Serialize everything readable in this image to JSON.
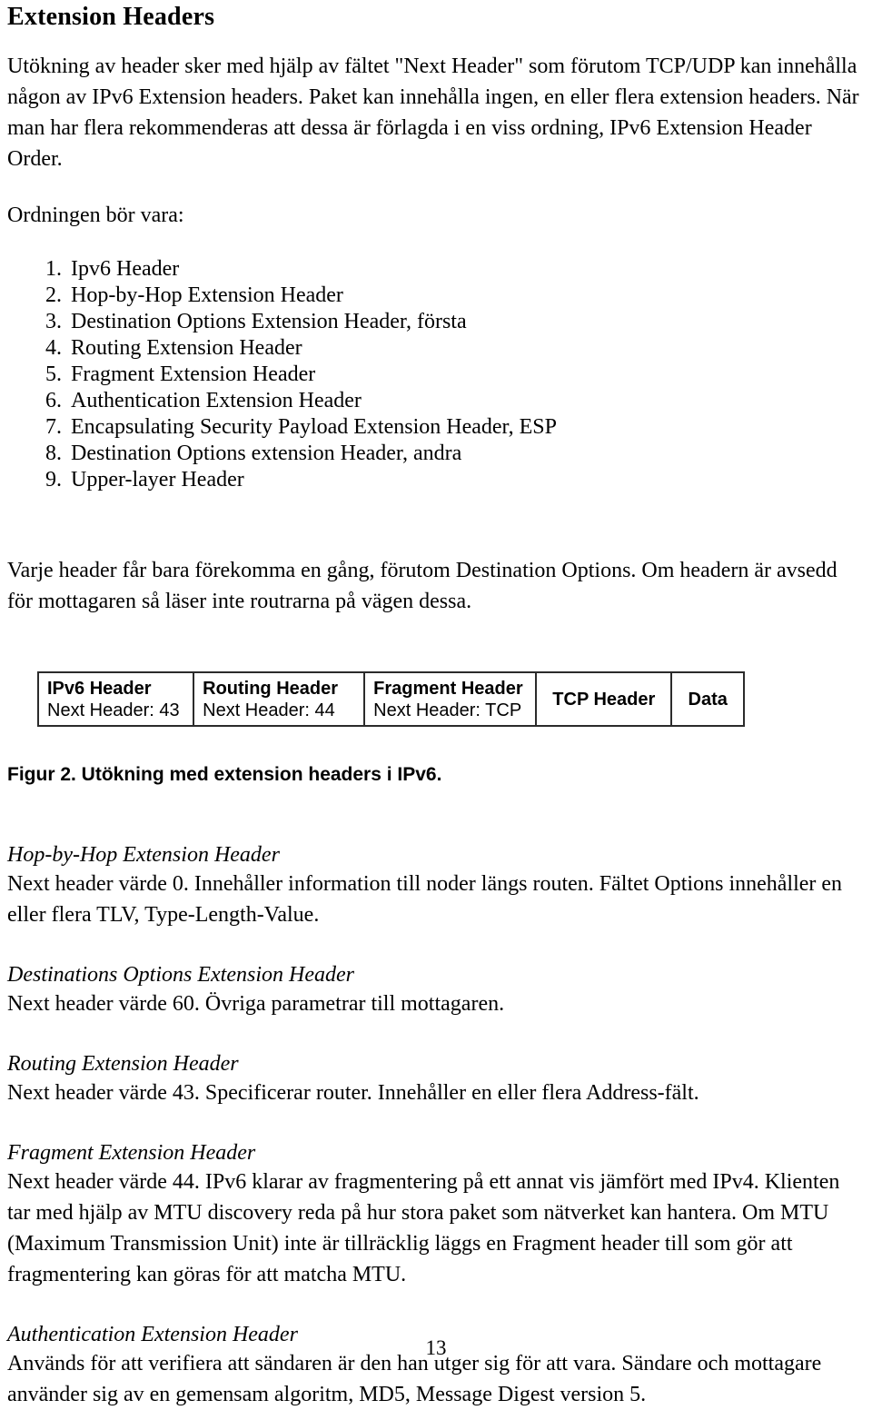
{
  "document": {
    "title": "Extension Headers",
    "page_number": "13"
  },
  "intro": {
    "paragraph": "Utökning av header sker med hjälp av fältet \"Next Header\" som förutom TCP/UDP kan innehålla någon av IPv6 Extension headers. Paket kan innehålla ingen, en eller flera extension headers. När man har flera rekommenderas att dessa är förlagda i en viss ordning, IPv6 Extension Header Order.",
    "order_intro": "Ordningen bör vara:"
  },
  "order_list": [
    {
      "num": "1.",
      "label": "Ipv6 Header"
    },
    {
      "num": "2.",
      "label": "Hop-by-Hop Extension Header"
    },
    {
      "num": "3.",
      "label": "Destination Options Extension Header, första"
    },
    {
      "num": "4.",
      "label": "Routing Extension Header"
    },
    {
      "num": "5.",
      "label": "Fragment Extension Header"
    },
    {
      "num": "6.",
      "label": "Authentication Extension Header"
    },
    {
      "num": "7.",
      "label": "Encapsulating Security Payload Extension Header, ESP"
    },
    {
      "num": "8.",
      "label": "Destination Options extension Header, andra"
    },
    {
      "num": "9.",
      "label": "Upper-layer Header"
    }
  ],
  "after_list": {
    "paragraph": "Varje header får bara förekomma en gång, förutom Destination Options. Om headern är avsedd för mottagaren så läser inte routrarna på vägen dessa."
  },
  "figure": {
    "caption": "Figur 2. Utökning med extension headers i IPv6.",
    "border_color": "#2b2b2b",
    "cells": [
      {
        "title": "IPv6 Header",
        "sub": "Next Header: 43",
        "centered": false
      },
      {
        "title": "Routing Header",
        "sub": "Next Header: 44",
        "centered": false
      },
      {
        "title": "Fragment Header",
        "sub": "Next Header: TCP",
        "centered": false
      },
      {
        "title": "TCP Header",
        "sub": "",
        "centered": true
      },
      {
        "title": "Data",
        "sub": "",
        "centered": true
      }
    ]
  },
  "sections": [
    {
      "heading": "Hop-by-Hop Extension Header",
      "body": "Next header värde 0. Innehåller information till noder längs routen. Fältet Options innehåller en eller flera TLV, Type-Length-Value."
    },
    {
      "heading": "Destinations Options Extension Header",
      "body": "Next header värde 60. Övriga parametrar till mottagaren."
    },
    {
      "heading": "Routing Extension Header",
      "body": "Next header värde 43. Specificerar router. Innehåller en eller flera Address-fält."
    },
    {
      "heading": "Fragment Extension Header",
      "body": "Next header värde 44. IPv6 klarar av fragmentering på ett annat vis jämfört med IPv4. Klienten tar med hjälp av MTU discovery reda på hur stora paket som nätverket kan hantera. Om MTU (Maximum Transmission Unit) inte är tillräcklig läggs en Fragment header till som gör att fragmentering kan göras för att matcha MTU."
    },
    {
      "heading": "Authentication Extension Header",
      "body": "Används för att verifiera att sändaren är den han utger sig för att vara. Sändare och mottagare använder sig av en gemensam algoritm, MD5, Message Digest version 5."
    }
  ]
}
